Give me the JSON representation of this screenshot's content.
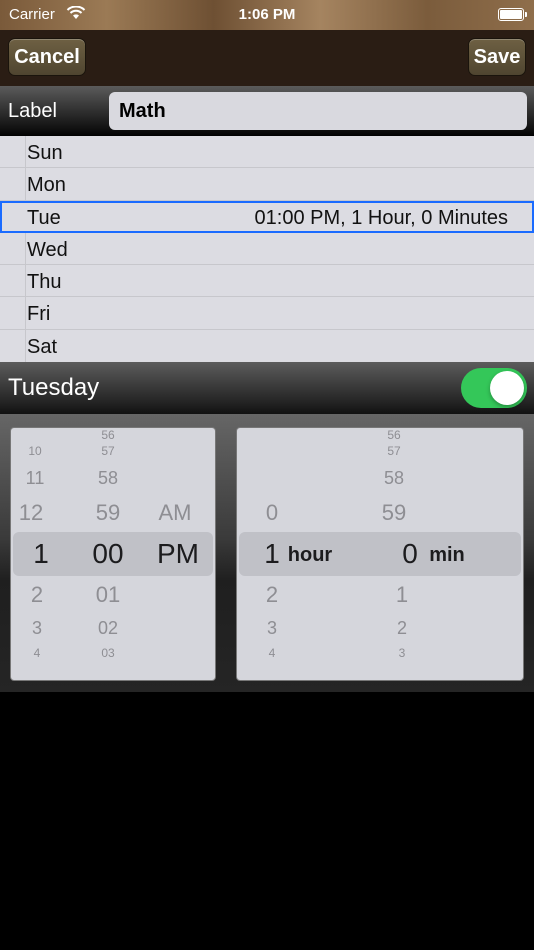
{
  "status_bar": {
    "carrier": "Carrier",
    "time": "1:06 PM"
  },
  "nav": {
    "cancel_label": "Cancel",
    "save_label": "Save"
  },
  "label_row": {
    "label": "Label",
    "value": "Math"
  },
  "days": [
    {
      "name": "Sun",
      "detail": ""
    },
    {
      "name": "Mon",
      "detail": ""
    },
    {
      "name": "Tue",
      "detail": "01:00 PM, 1 Hour, 0 Minutes",
      "selected": true
    },
    {
      "name": "Wed",
      "detail": ""
    },
    {
      "name": "Thu",
      "detail": ""
    },
    {
      "name": "Fri",
      "detail": ""
    },
    {
      "name": "Sat",
      "detail": ""
    }
  ],
  "day_header": {
    "title": "Tuesday",
    "enabled": true
  },
  "time_picker": {
    "hours": {
      "above3": "10",
      "above2": "11",
      "above1": "12",
      "selected": "1",
      "below1": "2",
      "below2": "3",
      "below3": "4"
    },
    "minutes": {
      "above4": "56",
      "above3": "57",
      "above2": "58",
      "above1": "59",
      "selected": "00",
      "below1": "01",
      "below2": "02",
      "below3": "03"
    },
    "ampm": {
      "above1": "AM",
      "selected": "PM"
    }
  },
  "duration_picker": {
    "hours": {
      "above1": "0",
      "selected": "1",
      "below1": "2",
      "below2": "3",
      "below3": "4",
      "unit": "hour"
    },
    "minutes": {
      "above4": "56",
      "above3": "57",
      "above2": "58",
      "above1": "59",
      "selected": "0",
      "below1": "1",
      "below2": "2",
      "below3": "3",
      "unit": "min"
    }
  },
  "colors": {
    "accent": "#1a6bff",
    "toggle_on": "#34c759"
  }
}
